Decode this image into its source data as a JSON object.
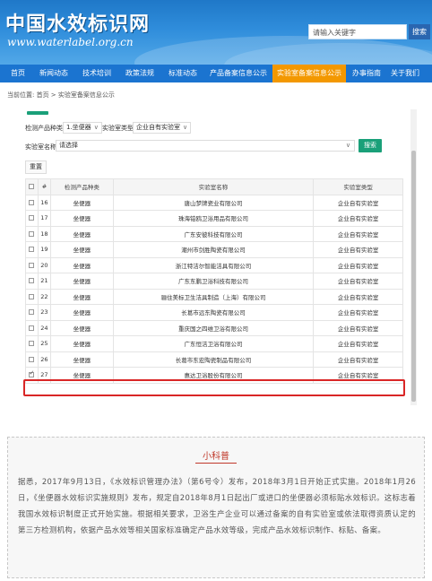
{
  "header": {
    "logo_cn": "中国水效标识网",
    "logo_en": "www.waterlabel.org.cn",
    "search_placeholder": "请输入关键字",
    "search_button": "搜索"
  },
  "nav": {
    "items": [
      {
        "label": "首页"
      },
      {
        "label": "新闻动态"
      },
      {
        "label": "技术培训"
      },
      {
        "label": "政策法规"
      },
      {
        "label": "标准动态"
      },
      {
        "label": "产品备案信息公示"
      },
      {
        "label": "实验室备案信息公示",
        "active": true
      },
      {
        "label": "办事指南"
      },
      {
        "label": "关于我们"
      }
    ]
  },
  "breadcrumb": "当前位置: 首页 > 实验室备案信息公示",
  "filters": {
    "product_type_label": "检测产品种类",
    "product_type_value": "1.坐便器",
    "lab_type_label": "实验室类型",
    "lab_type_value": "企业自有实验室",
    "lab_name_label": "实验室名称",
    "lab_name_value": "请选择",
    "search_button": "搜索",
    "reset_button": "重置"
  },
  "table": {
    "columns": [
      "#",
      "检测产品种类",
      "实验室名称",
      "实验室类型"
    ],
    "rows": [
      {
        "num": "16",
        "product": "坐便器",
        "name": "唐山梦牌瓷业有限公司",
        "type": "企业自有实验室",
        "checked": false
      },
      {
        "num": "17",
        "product": "坐便器",
        "name": "珠海铂鸥卫浴用品有限公司",
        "type": "企业自有实验室",
        "checked": false
      },
      {
        "num": "18",
        "product": "坐便器",
        "name": "广东安彼科技有限公司",
        "type": "企业自有实验室",
        "checked": false
      },
      {
        "num": "19",
        "product": "坐便器",
        "name": "潮州市剑胜陶瓷有限公司",
        "type": "企业自有实验室",
        "checked": false
      },
      {
        "num": "20",
        "product": "坐便器",
        "name": "浙江特洁尔智能洁具有限公司",
        "type": "企业自有实验室",
        "checked": false
      },
      {
        "num": "21",
        "product": "坐便器",
        "name": "广东东鹏卫浴科技有限公司",
        "type": "企业自有实验室",
        "checked": false
      },
      {
        "num": "22",
        "product": "坐便器",
        "name": "骊住美标卫生洁具制造（上海）有限公司",
        "type": "企业自有实验室",
        "checked": false
      },
      {
        "num": "23",
        "product": "坐便器",
        "name": "长葛市远东陶瓷有限公司",
        "type": "企业自有实验室",
        "checked": false
      },
      {
        "num": "24",
        "product": "坐便器",
        "name": "重庆国之四维卫浴有限公司",
        "type": "企业自有实验室",
        "checked": false
      },
      {
        "num": "25",
        "product": "坐便器",
        "name": "广东恒洁卫浴有限公司",
        "type": "企业自有实验室",
        "checked": false
      },
      {
        "num": "26",
        "product": "坐便器",
        "name": "长葛市东宏陶瓷制品有限公司",
        "type": "企业自有实验室",
        "checked": false
      },
      {
        "num": "27",
        "product": "坐便器",
        "name": "惠达卫浴股份有限公司",
        "type": "企业自有实验室",
        "checked": true
      }
    ]
  },
  "info": {
    "title": "小科普",
    "text": "据悉，2017年9月13日，《水效标识管理办法》（第6号令）发布，2018年3月1日开始正式实施。2018年1月26日，《坐便器水效标识实施规则》发布，规定自2018年8月1日起出厂或进口的坐便器必须标贴水效标识。这标志着我国水效标识制度正式开始实施。根据相关要求，卫浴生产企业可以通过备案的自有实验室或依法取得资质认定的第三方检测机构，依据产品水效等相关国家标准确定产品水效等级，完成产品水效标识制作、标贴、备案。"
  },
  "colors": {
    "header_blue": "#1f78c8",
    "nav_blue": "#1b74d0",
    "nav_active": "#f39800",
    "accent_green": "#1aa079",
    "highlight_red": "#d92626",
    "info_title": "#c0392b"
  }
}
